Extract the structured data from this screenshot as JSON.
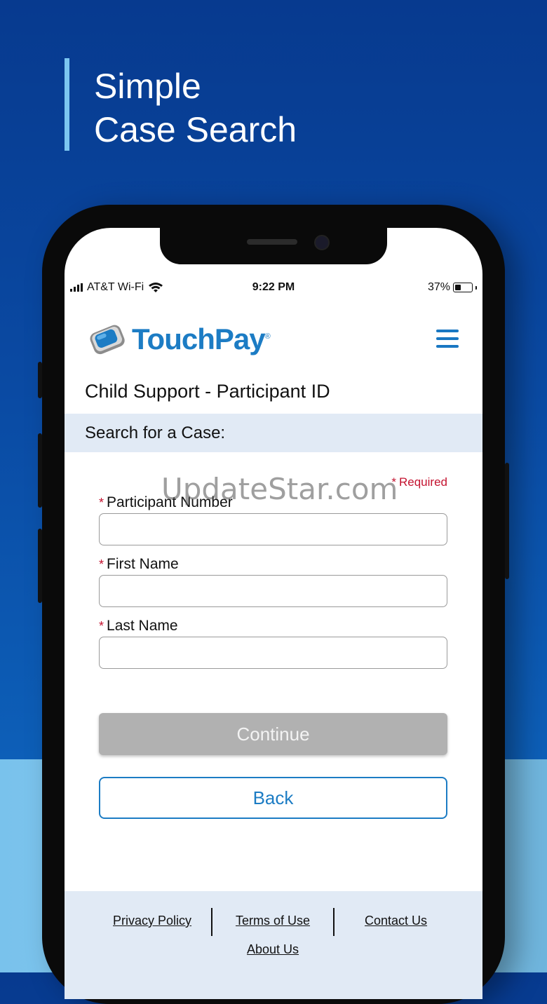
{
  "promo": {
    "headline_line1": "Simple",
    "headline_line2": "Case Search"
  },
  "status_bar": {
    "carrier": "AT&T Wi-Fi",
    "time": "9:22 PM",
    "battery": "37%",
    "battery_level": 0.37
  },
  "app": {
    "logo_text": "TouchPay",
    "logo_mark": "®",
    "page_title": "Child Support - Participant ID",
    "section_label": "Search for a Case:",
    "required_note": "Required",
    "watermark": "UpdateStar.com",
    "fields": [
      {
        "label": "Participant Number",
        "value": ""
      },
      {
        "label": "First Name",
        "value": ""
      },
      {
        "label": "Last Name",
        "value": ""
      }
    ],
    "continue_label": "Continue",
    "back_label": "Back"
  },
  "footer": {
    "privacy": "Privacy Policy",
    "terms": "Terms of Use",
    "contact": "Contact Us",
    "about": "About Us"
  },
  "colors": {
    "brand_blue": "#1c7cc4",
    "required_red": "#c4122f",
    "section_bg": "#e1eaf5",
    "disabled_button": "#b1b1b1"
  },
  "icons": [
    "signal-icon",
    "wifi-icon",
    "battery-icon",
    "touchpay-logo-icon",
    "hamburger-menu-icon"
  ]
}
